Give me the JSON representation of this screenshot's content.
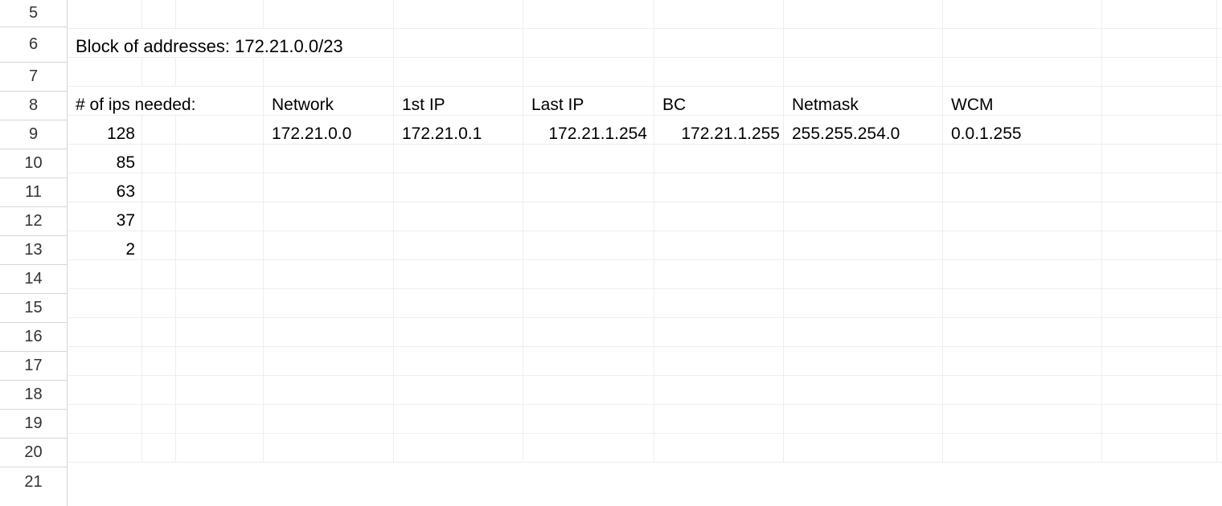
{
  "rowNumbers": [
    "5",
    "6",
    "7",
    "8",
    "9",
    "10",
    "11",
    "12",
    "13",
    "14",
    "15",
    "16",
    "17",
    "18",
    "19",
    "20",
    "21"
  ],
  "row6": {
    "text": "Block of addresses: 172.21.0.0/23"
  },
  "row8": {
    "A": "# of ips needed:",
    "D": "Network",
    "E": "1st IP",
    "F": "Last IP",
    "G": "BC",
    "H": "Netmask",
    "I": "WCM"
  },
  "row9": {
    "A": "128",
    "D": "172.21.0.0",
    "E": "172.21.0.1",
    "F": "172.21.1.254",
    "G": "172.21.1.255",
    "H": "255.255.254.0",
    "I": "0.0.1.255"
  },
  "row10": {
    "A": "85"
  },
  "row11": {
    "A": "63"
  },
  "row12": {
    "A": "37"
  },
  "row13": {
    "A": "2"
  }
}
